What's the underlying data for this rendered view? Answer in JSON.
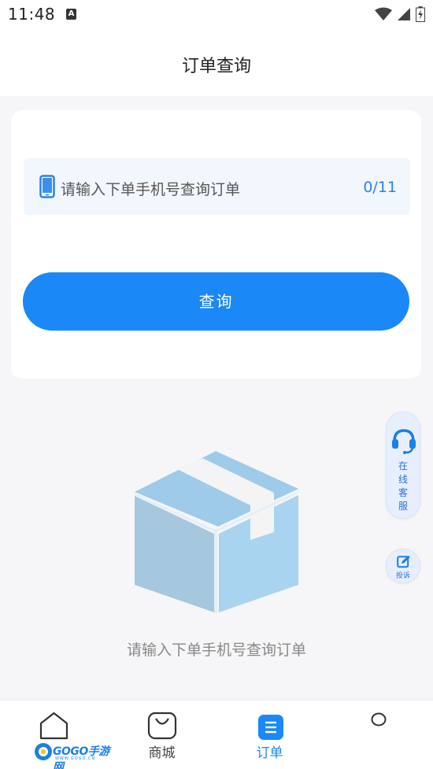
{
  "status_bar": {
    "time": "11:48",
    "notification_icon": "A"
  },
  "header": {
    "title": "订单查询"
  },
  "search_card": {
    "input_placeholder": "请输入下单手机号查询订单",
    "input_counter": "0/11",
    "query_button": "查询"
  },
  "empty_state": {
    "message": "请输入下单手机号查询订单"
  },
  "floating": {
    "service_label": "在线客服",
    "complaint_label": "投诉"
  },
  "tabs": [
    {
      "label": "",
      "icon": "home-icon",
      "active": false
    },
    {
      "label": "商城",
      "icon": "shopping-bag-icon",
      "active": false
    },
    {
      "label": "订单",
      "icon": "order-list-icon",
      "active": true
    },
    {
      "label": "",
      "icon": "profile-icon",
      "active": false
    }
  ],
  "watermark": {
    "brand": "GOGO手游网",
    "url": "WWW.GOGO.CN"
  },
  "colors": {
    "accent": "#1a88f6",
    "input_bg": "#f2f7fe",
    "box": "#a9d4ef"
  }
}
